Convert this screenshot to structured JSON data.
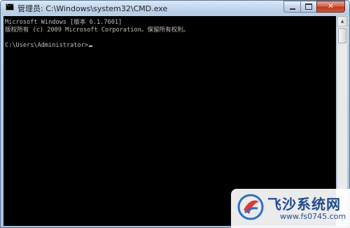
{
  "window": {
    "title": "管理员: C:\\Windows\\system32\\CMD.exe",
    "icon": "cmd-icon",
    "icon_text": "C:\\"
  },
  "controls": {
    "minimize": "minimize-icon",
    "maximize": "maximize-icon",
    "close_label": "✕"
  },
  "console": {
    "lines": [
      "Microsoft Windows [版本 6.1.7601]",
      "版权所有 (c) 2009 Microsoft Corporation。保留所有权利。",
      "",
      "C:\\Users\\Administrator>"
    ],
    "background": "#000000",
    "foreground": "#c0c0c0"
  },
  "watermark": {
    "title": "飞沙系统网",
    "url": "www.fs0745.com"
  }
}
